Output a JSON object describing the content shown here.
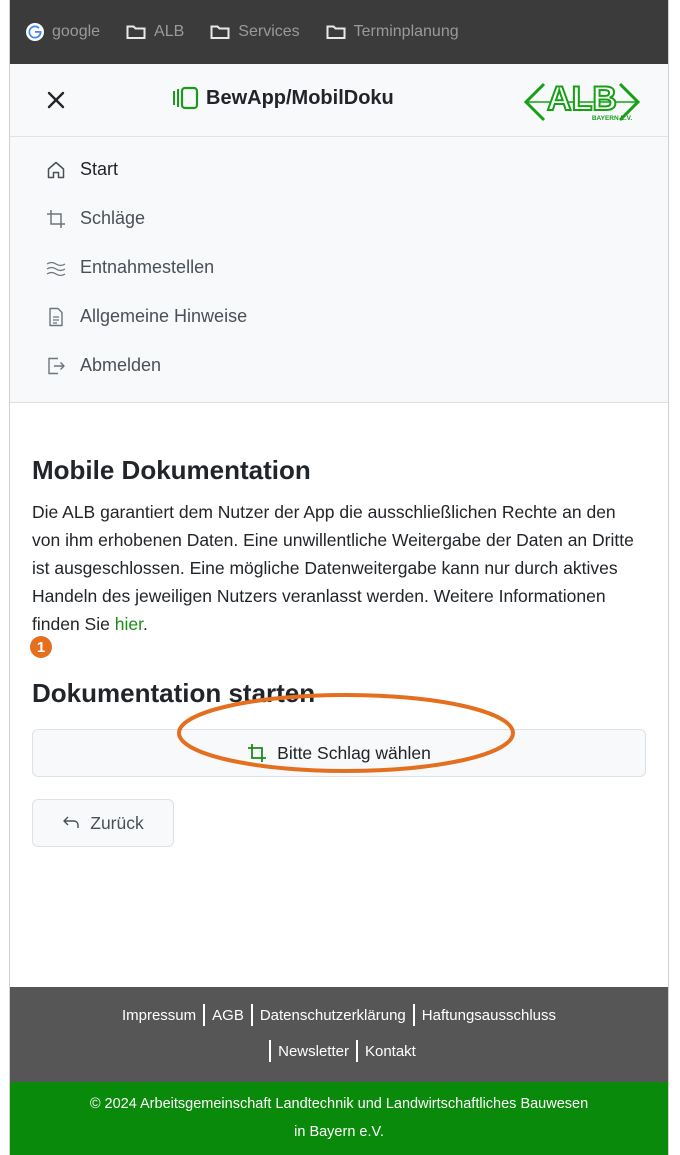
{
  "bookmarks": [
    {
      "label": "google",
      "icon": "google-icon"
    },
    {
      "label": "ALB",
      "icon": "folder-icon"
    },
    {
      "label": "Services",
      "icon": "folder-icon"
    },
    {
      "label": "Terminplanung",
      "icon": "folder-icon"
    }
  ],
  "header": {
    "title": "BewApp/MobilDoku",
    "logo_text": "ALB",
    "logo_subtext": "BAYERN E.V."
  },
  "nav": {
    "items": [
      {
        "label": "Start",
        "icon": "home-icon"
      },
      {
        "label": "Schläge",
        "icon": "crop-icon"
      },
      {
        "label": "Entnahmestellen",
        "icon": "water-icon"
      },
      {
        "label": "Allgemeine Hinweise",
        "icon": "document-icon"
      },
      {
        "label": "Abmelden",
        "icon": "logout-icon"
      }
    ]
  },
  "main": {
    "title": "Mobile Dokumentation",
    "intro": "Die ALB garantiert dem Nutzer der App die ausschließlichen Rechte an den von ihm erhobenen Daten. Eine unwillentliche Weitergabe der Daten an Dritte ist ausgeschlossen. Eine mögliche Datenweitergabe kann nur durch aktives Handeln des jeweiligen Nutzers veranlasst werden. Weitere Informationen finden Sie",
    "intro_link": "hier",
    "intro_end": ".",
    "step_badge": "1",
    "start_title": "Dokumentation starten",
    "choose_button": "Bitte Schlag wählen",
    "back_button": "Zurück"
  },
  "footer": {
    "links_row1": [
      "Impressum",
      "AGB",
      "Datenschutzerklärung",
      "Haftungsausschluss"
    ],
    "links_row2": [
      "Newsletter",
      "Kontakt"
    ],
    "copyright_line1": "© 2024 Arbeitsgemeinschaft Landtechnik und Landwirtschaftliches Bauwesen",
    "copyright_line2": "in Bayern e.V."
  },
  "colors": {
    "accent_green": "#198c19",
    "footer_green": "#0a8a0a",
    "annotation_orange": "#e46f1f"
  }
}
